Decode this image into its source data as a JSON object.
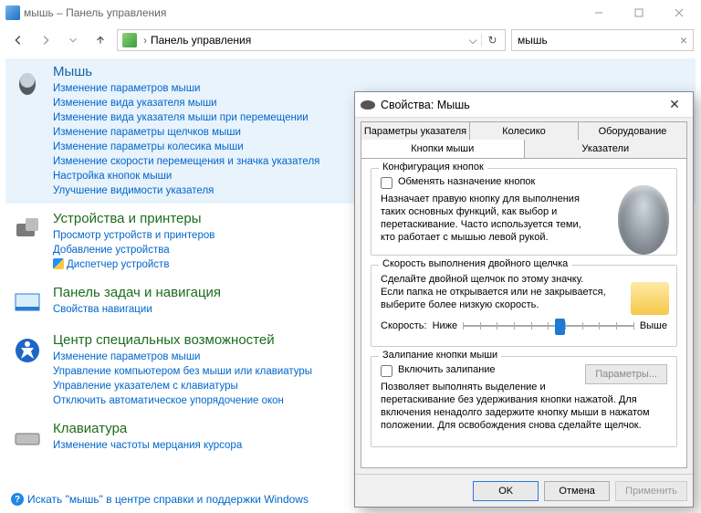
{
  "window": {
    "title": "мышь – Панель управления",
    "addressbar": {
      "crumb": "Панель управления"
    },
    "search": {
      "value": "мышь"
    }
  },
  "groups": [
    {
      "heading": "Мышь",
      "highlighted": true,
      "headingClass": "blue",
      "links": [
        "Изменение параметров мыши",
        "Изменение вида указателя мыши",
        "Изменение вида указателя мыши при перемещении",
        "Изменение параметры щелчков мыши",
        "Изменение параметры колесика мыши",
        "Изменение скорости перемещения и значка указателя",
        "Настройка кнопок мыши",
        "Улучшение видимости указателя"
      ]
    },
    {
      "heading": "Устройства и принтеры",
      "links": [
        "Просмотр устройств и принтеров",
        "Добавление устройства",
        "Диспетчер устройств"
      ],
      "shield_indices": [
        2
      ]
    },
    {
      "heading": "Панель задач и навигация",
      "links": [
        "Свойства навигации"
      ]
    },
    {
      "heading": "Центр специальных возможностей",
      "links": [
        "Изменение параметров мыши",
        "Управление компьютером без мыши или клавиатуры",
        "Управление указателем с клавиатуры",
        "Отключить автоматическое упорядочение окон"
      ]
    },
    {
      "heading": "Клавиатура",
      "links": [
        "Изменение частоты мерцания курсора"
      ]
    }
  ],
  "help_link": "Искать \"мышь\" в центре справки и поддержки Windows",
  "dialog": {
    "title": "Свойства: Мышь",
    "tabs_row1": [
      "Параметры указателя",
      "Колесико",
      "Оборудование"
    ],
    "tabs_row2": [
      "Кнопки мыши",
      "Указатели"
    ],
    "active_tab": "Кнопки мыши",
    "section1": {
      "legend": "Конфигурация кнопок",
      "checkbox": "Обменять назначение кнопок",
      "desc": "Назначает правую кнопку для выполнения таких основных функций, как выбор и перетаскивание. Часто используется теми, кто работает с мышью левой рукой."
    },
    "section2": {
      "legend": "Скорость выполнения двойного щелчка",
      "desc": "Сделайте двойной щелчок по этому значку. Если папка не открывается или не закрывается, выберите более низкую скорость.",
      "speed_label": "Скорость:",
      "slow": "Ниже",
      "fast": "Выше"
    },
    "section3": {
      "legend": "Залипание кнопки мыши",
      "checkbox": "Включить залипание",
      "param_btn": "Параметры...",
      "desc": "Позволяет выполнять выделение и перетаскивание без удерживания кнопки нажатой. Для включения ненадолго задержите кнопку мыши в нажатом положении. Для освобождения снова сделайте щелчок."
    },
    "buttons": {
      "ok": "OK",
      "cancel": "Отмена",
      "apply": "Применить"
    }
  }
}
